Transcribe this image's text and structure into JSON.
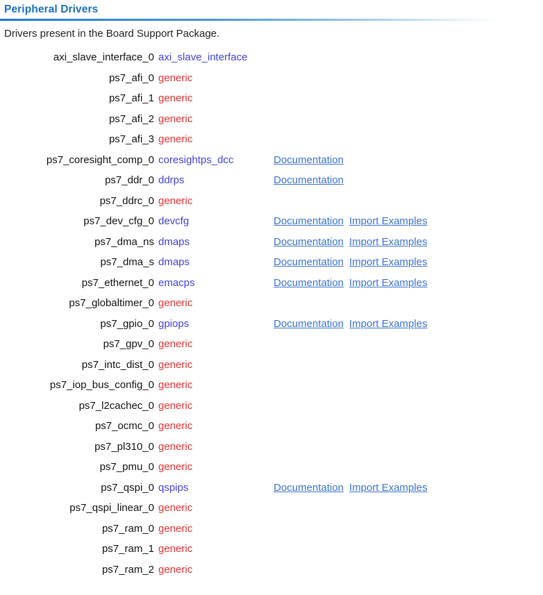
{
  "header": {
    "title": "Peripheral Drivers",
    "description": "Drivers present in the Board Support Package."
  },
  "links": {
    "documentation_label": "Documentation",
    "import_examples_label": "Import Examples"
  },
  "colors": {
    "title": "#1a6fc4",
    "rule": "#1277d4",
    "driver_specific": "#4040e0",
    "driver_generic": "#e03030",
    "hyperlink": "#3a72d0",
    "text": "#111111",
    "background": "#ffffff"
  },
  "drivers": [
    {
      "instance": "axi_slave_interface_0",
      "driver": "axi_slave_interface",
      "generic": false,
      "documentation": false,
      "import_examples": false
    },
    {
      "instance": "ps7_afi_0",
      "driver": "generic",
      "generic": true,
      "documentation": false,
      "import_examples": false
    },
    {
      "instance": "ps7_afi_1",
      "driver": "generic",
      "generic": true,
      "documentation": false,
      "import_examples": false
    },
    {
      "instance": "ps7_afi_2",
      "driver": "generic",
      "generic": true,
      "documentation": false,
      "import_examples": false
    },
    {
      "instance": "ps7_afi_3",
      "driver": "generic",
      "generic": true,
      "documentation": false,
      "import_examples": false
    },
    {
      "instance": "ps7_coresight_comp_0",
      "driver": "coresightps_dcc",
      "generic": false,
      "documentation": true,
      "import_examples": false
    },
    {
      "instance": "ps7_ddr_0",
      "driver": "ddrps",
      "generic": false,
      "documentation": true,
      "import_examples": false
    },
    {
      "instance": "ps7_ddrc_0",
      "driver": "generic",
      "generic": true,
      "documentation": false,
      "import_examples": false
    },
    {
      "instance": "ps7_dev_cfg_0",
      "driver": "devcfg",
      "generic": false,
      "documentation": true,
      "import_examples": true
    },
    {
      "instance": "ps7_dma_ns",
      "driver": "dmaps",
      "generic": false,
      "documentation": true,
      "import_examples": true
    },
    {
      "instance": "ps7_dma_s",
      "driver": "dmaps",
      "generic": false,
      "documentation": true,
      "import_examples": true
    },
    {
      "instance": "ps7_ethernet_0",
      "driver": "emacps",
      "generic": false,
      "documentation": true,
      "import_examples": true
    },
    {
      "instance": "ps7_globaltimer_0",
      "driver": "generic",
      "generic": true,
      "documentation": false,
      "import_examples": false
    },
    {
      "instance": "ps7_gpio_0",
      "driver": "gpiops",
      "generic": false,
      "documentation": true,
      "import_examples": true
    },
    {
      "instance": "ps7_gpv_0",
      "driver": "generic",
      "generic": true,
      "documentation": false,
      "import_examples": false
    },
    {
      "instance": "ps7_intc_dist_0",
      "driver": "generic",
      "generic": true,
      "documentation": false,
      "import_examples": false
    },
    {
      "instance": "ps7_iop_bus_config_0",
      "driver": "generic",
      "generic": true,
      "documentation": false,
      "import_examples": false
    },
    {
      "instance": "ps7_l2cachec_0",
      "driver": "generic",
      "generic": true,
      "documentation": false,
      "import_examples": false
    },
    {
      "instance": "ps7_ocmc_0",
      "driver": "generic",
      "generic": true,
      "documentation": false,
      "import_examples": false
    },
    {
      "instance": "ps7_pl310_0",
      "driver": "generic",
      "generic": true,
      "documentation": false,
      "import_examples": false
    },
    {
      "instance": "ps7_pmu_0",
      "driver": "generic",
      "generic": true,
      "documentation": false,
      "import_examples": false
    },
    {
      "instance": "ps7_qspi_0",
      "driver": "qspips",
      "generic": false,
      "documentation": true,
      "import_examples": true
    },
    {
      "instance": "ps7_qspi_linear_0",
      "driver": "generic",
      "generic": true,
      "documentation": false,
      "import_examples": false
    },
    {
      "instance": "ps7_ram_0",
      "driver": "generic",
      "generic": true,
      "documentation": false,
      "import_examples": false
    },
    {
      "instance": "ps7_ram_1",
      "driver": "generic",
      "generic": true,
      "documentation": false,
      "import_examples": false
    },
    {
      "instance": "ps7_ram_2",
      "driver": "generic",
      "generic": true,
      "documentation": false,
      "import_examples": false
    }
  ]
}
